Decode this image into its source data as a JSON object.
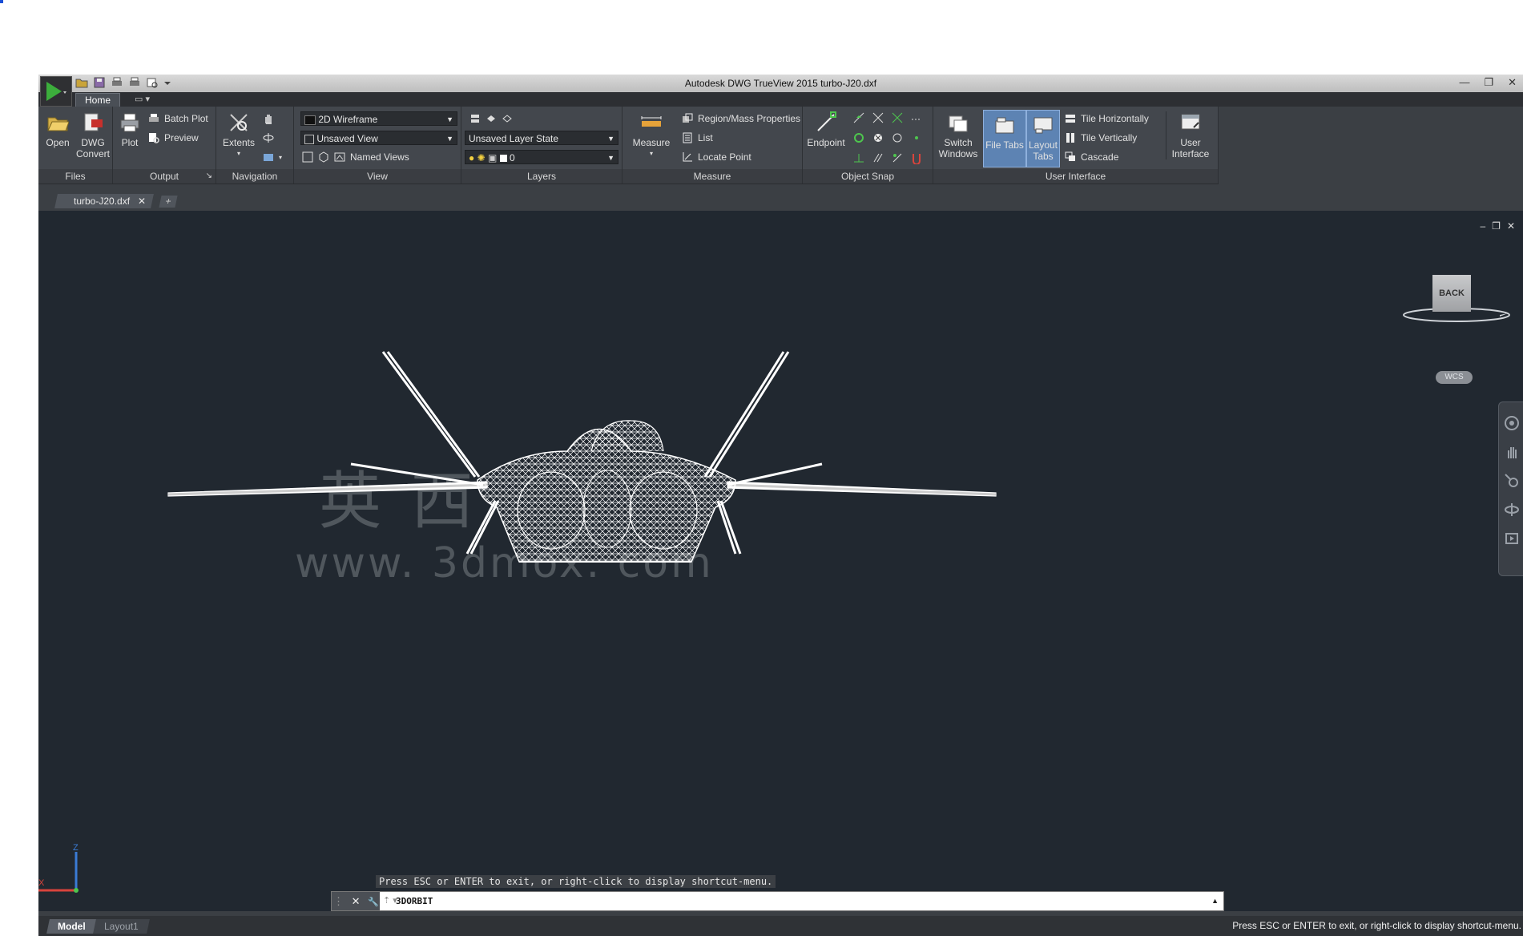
{
  "window": {
    "title": "Autodesk DWG TrueView 2015   turbo-J20.dxf",
    "controls": [
      "—",
      "❐",
      "✕"
    ]
  },
  "ribbon_tabs": {
    "home": "Home",
    "extra": "▭ ▾"
  },
  "panels": {
    "files": {
      "title": "Files",
      "open": "Open",
      "dwg_convert_1": "DWG",
      "dwg_convert_2": "Convert"
    },
    "output": {
      "title": "Output",
      "plot": "Plot",
      "batch_plot": "Batch Plot",
      "preview": "Preview",
      "launcher": "↘"
    },
    "navigation": {
      "title": "Navigation",
      "extents": "Extents"
    },
    "view": {
      "title": "View",
      "visual_style": "2D Wireframe",
      "named_view": "Unsaved View",
      "named_views": "Named Views"
    },
    "layers": {
      "title": "Layers",
      "layer_state": "Unsaved Layer State",
      "current_layer": "0"
    },
    "measure": {
      "title": "Measure",
      "measure": "Measure",
      "region_mass": "Region/Mass Properties",
      "list": "List",
      "locate_point": "Locate Point"
    },
    "object_snap": {
      "title": "Object Snap",
      "endpoint": "Endpoint"
    },
    "user_interface": {
      "title": "User Interface",
      "switch_windows_1": "Switch",
      "switch_windows_2": "Windows",
      "file_tabs": "File Tabs",
      "layout_tabs_1": "Layout",
      "layout_tabs_2": "Tabs",
      "tile_h": "Tile Horizontally",
      "tile_v": "Tile Vertically",
      "cascade": "Cascade",
      "user_interface_1": "User",
      "user_interface_2": "Interface"
    }
  },
  "document_tabs": {
    "active": "turbo-J20.dxf",
    "close": "✕",
    "new": "+"
  },
  "viewport": {
    "controls": [
      "–",
      "❐",
      "✕"
    ],
    "viewcube_face": "BACK",
    "wcs_label": "WCS",
    "ucs_z": "Z",
    "ucs_x": "X",
    "watermark_cn": "英 西",
    "watermark_url": "www. 3dmox. com"
  },
  "command": {
    "history": "Press ESC or ENTER to exit, or right-click to display shortcut-menu.",
    "current": "3DORBIT",
    "close": "✕",
    "settings": "🔧"
  },
  "status": {
    "tab_model": "Model",
    "tab_layout1": "Layout1",
    "message": "Press ESC or ENTER to exit, or right-click to display shortcut-menu."
  },
  "colors": {
    "viewport_bg": "#212830",
    "ribbon_bg": "#43474d",
    "active_toggle": "#5d83b3",
    "wireframe": "#ffffff"
  }
}
